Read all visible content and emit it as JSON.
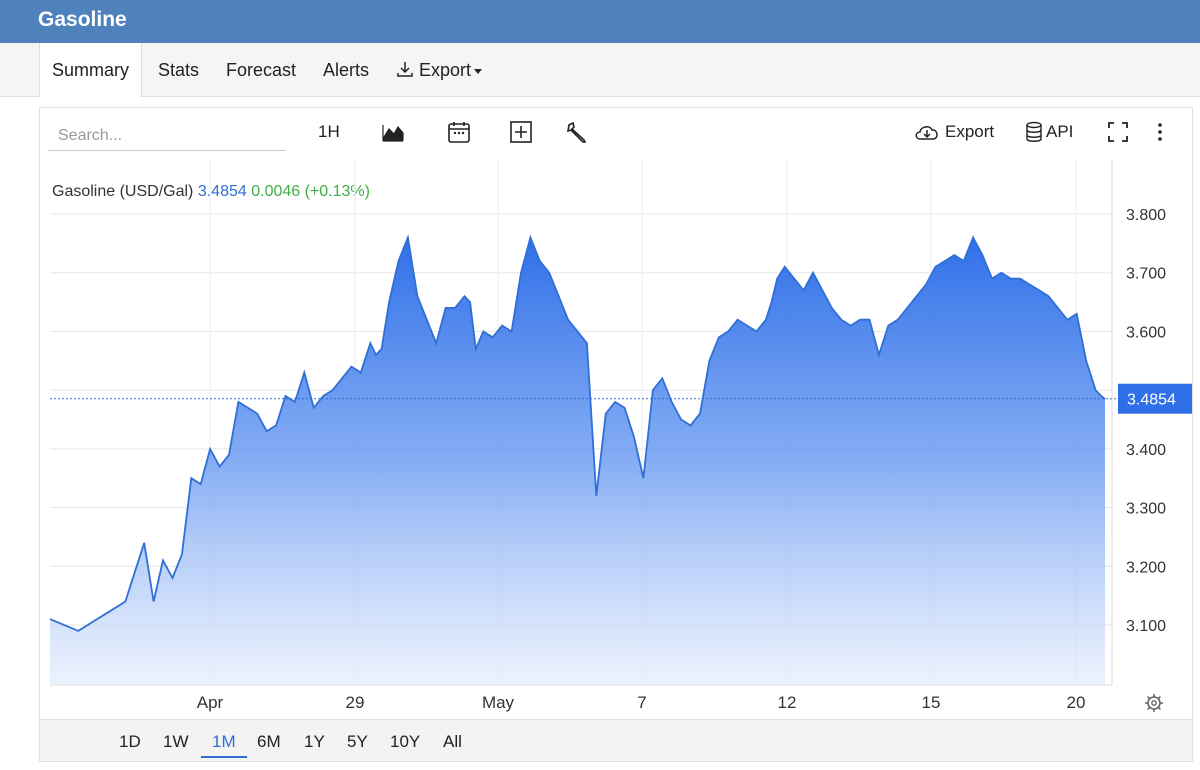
{
  "header": {
    "title": "Gasoline"
  },
  "nav": {
    "tabs": [
      "Summary",
      "Stats",
      "Forecast",
      "Alerts",
      "Export"
    ]
  },
  "toolbar": {
    "search_placeholder": "Search...",
    "interval": "1H",
    "export_label": "Export",
    "api_label": "API"
  },
  "legend": {
    "name": "Gasoline (USD/Gal)",
    "price": "3.4854",
    "change": "0.0046 (+0.13%)"
  },
  "ranges": [
    "1D",
    "1W",
    "1M",
    "6M",
    "1Y",
    "5Y",
    "10Y",
    "All"
  ],
  "active_range": "1M",
  "colors": {
    "accent": "#4f81bd",
    "line": "#2f6fd6",
    "positive": "#3fae49"
  },
  "chart_data": {
    "type": "area",
    "xlabel": "",
    "ylabel": "",
    "ylim": [
      3.0,
      3.85
    ],
    "yticks": [
      "3.800",
      "3.700",
      "3.600",
      "3.500",
      "3.400",
      "3.300",
      "3.200",
      "3.100"
    ],
    "xticks": [
      "Apr",
      "29",
      "May",
      "7",
      "12",
      "15",
      "20"
    ],
    "last_value": "3.4854",
    "grid": true,
    "series": [
      {
        "name": "Gasoline (USD/Gal)",
        "x": [
          0,
          1.5,
          2.5,
          3,
          4,
          5,
          5.5,
          6,
          6.5,
          7,
          7.5,
          8,
          8.5,
          9,
          9.5,
          10,
          10.5,
          11,
          11.5,
          12,
          12.5,
          13,
          13.3,
          13.5,
          14,
          14.5,
          15,
          15.5,
          16,
          16.5,
          17,
          17.3,
          17.6,
          18,
          18.5,
          19,
          19.5,
          20,
          20.5,
          21,
          21.5,
          22,
          22.3,
          22.6,
          23,
          23.5,
          24,
          24.5,
          25,
          25.5,
          26,
          26.5,
          27,
          27.5,
          28,
          28.5,
          29,
          29.5,
          30,
          30.5,
          31,
          31.5,
          32,
          32.5,
          33,
          33.5,
          34,
          34.5,
          35,
          35.5,
          36,
          36.5,
          37,
          37.5,
          38,
          38.3,
          38.6,
          39,
          39.5,
          40,
          40.5,
          41,
          41.5,
          42,
          42.5,
          43,
          43.5,
          44,
          44.5,
          45,
          45.5,
          46,
          46.5,
          47,
          47.5,
          48,
          48.5,
          49,
          49.5,
          50,
          50.5,
          51,
          51.5,
          52,
          52.5,
          53,
          53.5,
          54,
          54.5,
          55,
          55.5,
          55.8,
          56
        ],
        "values": [
          3.11,
          3.09,
          3.11,
          3.12,
          3.14,
          3.24,
          3.14,
          3.21,
          3.18,
          3.22,
          3.35,
          3.34,
          3.4,
          3.37,
          3.39,
          3.48,
          3.47,
          3.46,
          3.43,
          3.44,
          3.49,
          3.48,
          3.51,
          3.53,
          3.47,
          3.49,
          3.5,
          3.52,
          3.54,
          3.53,
          3.58,
          3.56,
          3.57,
          3.65,
          3.72,
          3.76,
          3.66,
          3.62,
          3.58,
          3.64,
          3.64,
          3.66,
          3.65,
          3.57,
          3.6,
          3.59,
          3.61,
          3.6,
          3.7,
          3.76,
          3.72,
          3.7,
          3.66,
          3.62,
          3.6,
          3.58,
          3.32,
          3.46,
          3.48,
          3.47,
          3.42,
          3.35,
          3.5,
          3.52,
          3.48,
          3.45,
          3.44,
          3.46,
          3.55,
          3.59,
          3.6,
          3.62,
          3.61,
          3.6,
          3.62,
          3.65,
          3.69,
          3.71,
          3.69,
          3.67,
          3.7,
          3.67,
          3.64,
          3.62,
          3.61,
          3.62,
          3.62,
          3.56,
          3.61,
          3.62,
          3.64,
          3.66,
          3.68,
          3.71,
          3.72,
          3.73,
          3.72,
          3.76,
          3.73,
          3.69,
          3.7,
          3.69,
          3.69,
          3.68,
          3.67,
          3.66,
          3.64,
          3.62,
          3.63,
          3.55,
          3.5,
          3.49,
          3.485
        ]
      }
    ]
  }
}
